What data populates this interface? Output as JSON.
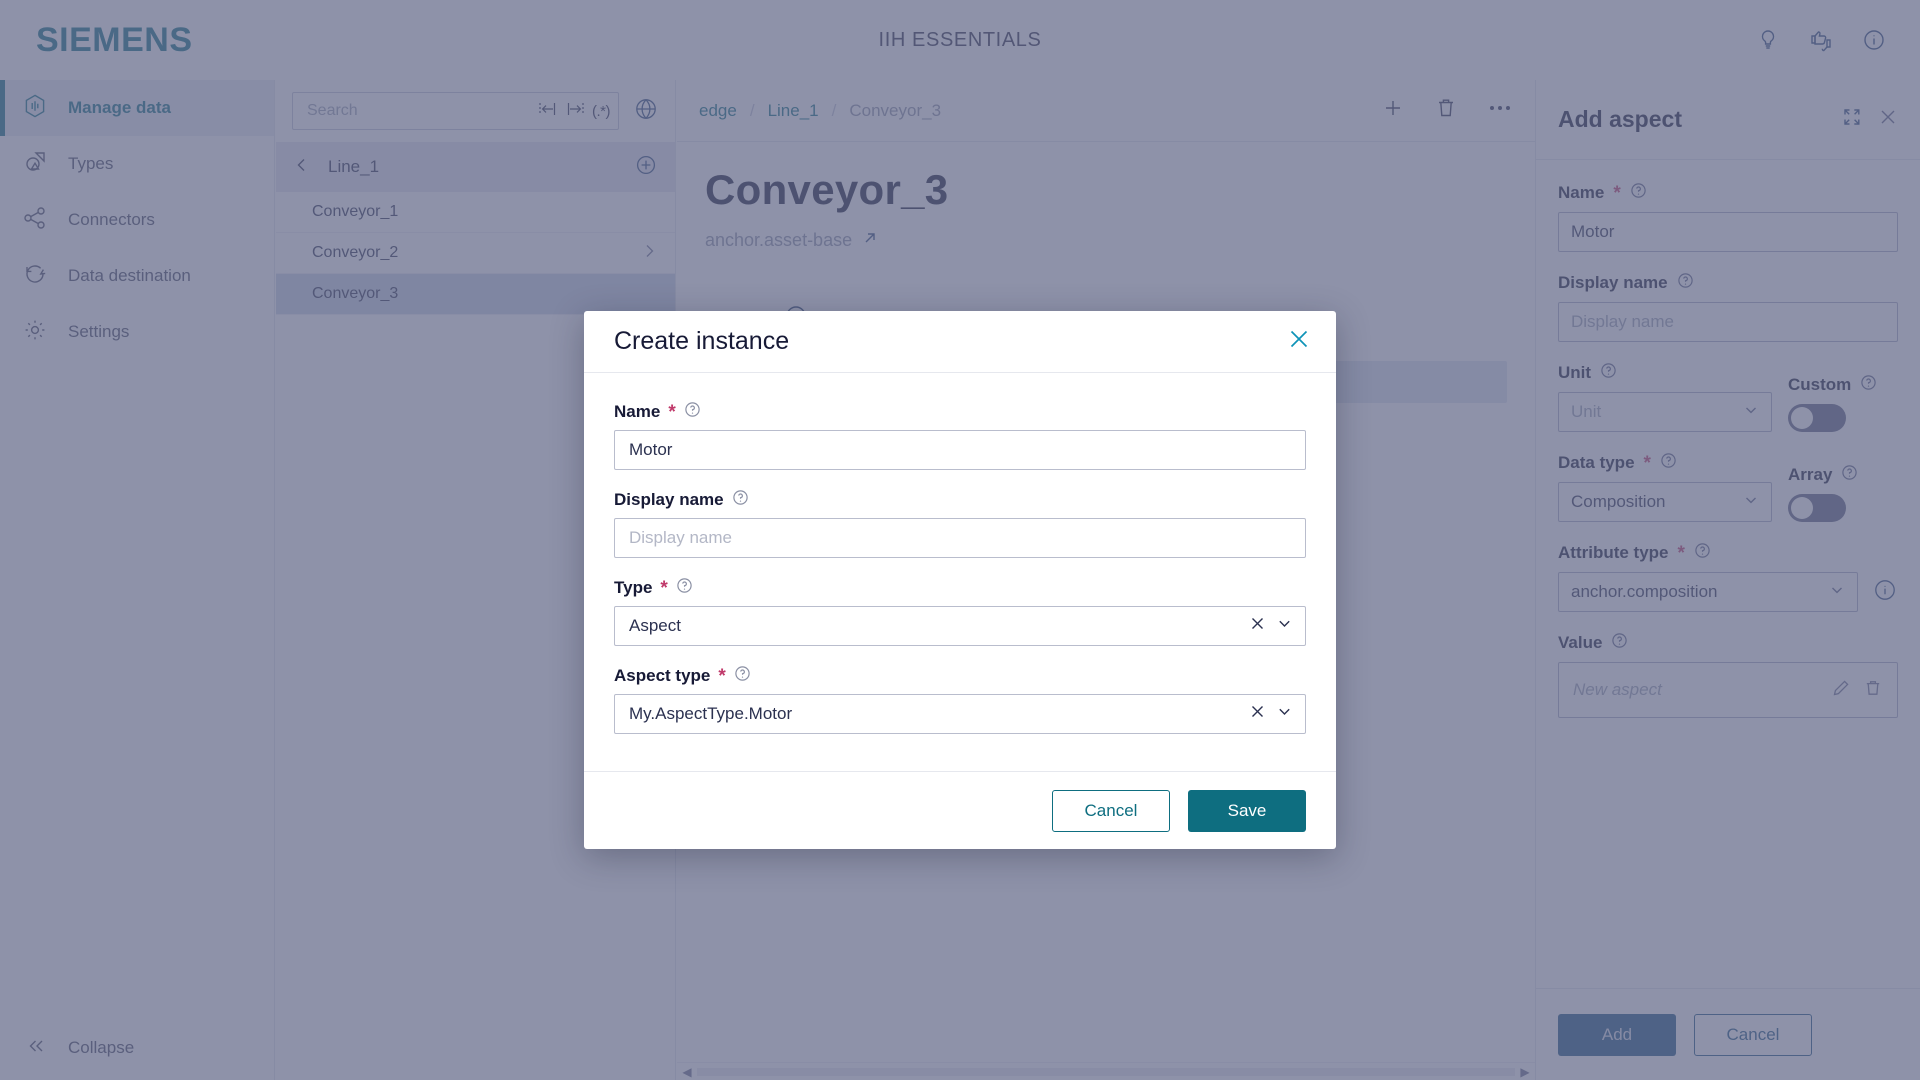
{
  "header": {
    "brand": "SIEMENS",
    "app_title": "IIH ESSENTIALS",
    "icons": [
      "lightbulb-icon",
      "feedback-icon",
      "info-icon"
    ]
  },
  "sidebar": {
    "items": [
      {
        "label": "Manage data",
        "icon": "manage-data-icon",
        "active": true
      },
      {
        "label": "Types",
        "icon": "types-icon",
        "active": false
      },
      {
        "label": "Connectors",
        "icon": "connectors-icon",
        "active": false
      },
      {
        "label": "Data destination",
        "icon": "data-destination-icon",
        "active": false
      },
      {
        "label": "Settings",
        "icon": "settings-icon",
        "active": false
      }
    ],
    "collapse_label": "Collapse"
  },
  "tree": {
    "search_placeholder": "Search",
    "search_value": "",
    "regex_label": "(.*)",
    "root_label": "Line_1",
    "items": [
      {
        "label": "Conveyor_1",
        "selected": false,
        "has_children": false
      },
      {
        "label": "Conveyor_2",
        "selected": false,
        "has_children": true
      },
      {
        "label": "Conveyor_3",
        "selected": true,
        "has_children": false
      }
    ]
  },
  "breadcrumb": {
    "items": [
      "edge",
      "Line_1",
      "Conveyor_3"
    ],
    "separator": "/"
  },
  "main": {
    "title": "Conveyor_3",
    "subtitle": "anchor.asset-base",
    "toolbar": {
      "delete_label": "Delete",
      "add_aspect_label": "Add aspect",
      "more_label": "•••"
    }
  },
  "right_panel": {
    "title": "Add aspect",
    "fields": {
      "name_label": "Name",
      "name_value": "Motor",
      "display_name_label": "Display name",
      "display_name_placeholder": "Display name",
      "unit_label": "Unit",
      "unit_placeholder": "Unit",
      "custom_label": "Custom",
      "custom_on": false,
      "data_type_label": "Data type",
      "data_type_value": "Composition",
      "array_label": "Array",
      "array_on": false,
      "attribute_type_label": "Attribute type",
      "attribute_type_value": "anchor.composition",
      "value_label": "Value",
      "value_placeholder": "New aspect"
    },
    "buttons": {
      "add_label": "Add",
      "cancel_label": "Cancel"
    }
  },
  "modal": {
    "title": "Create instance",
    "fields": {
      "name_label": "Name",
      "name_value": "Motor",
      "display_name_label": "Display name",
      "display_name_placeholder": "Display name",
      "type_label": "Type",
      "type_value": "Aspect",
      "aspect_type_label": "Aspect type",
      "aspect_type_value": "My.AspectType.Motor"
    },
    "buttons": {
      "cancel_label": "Cancel",
      "save_label": "Save"
    }
  },
  "colors": {
    "brand_teal": "#0e6e80",
    "accent_blue": "#24406b",
    "required_red": "#c0396a",
    "scrim": "rgba(98,104,136,0.72)"
  }
}
